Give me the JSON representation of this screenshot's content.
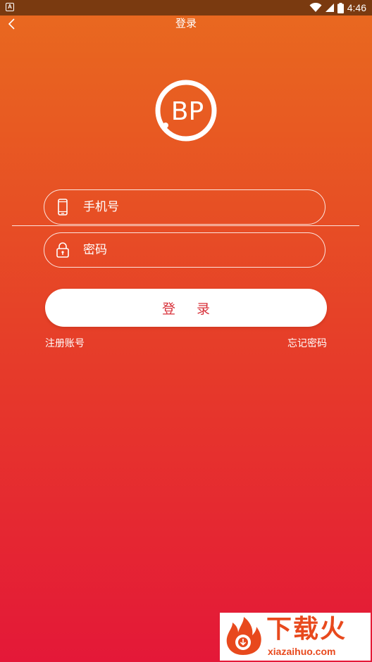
{
  "status_bar": {
    "notification_icon": "A",
    "icons": [
      "wifi-icon",
      "cell-signal-icon",
      "battery-icon"
    ],
    "time": "4:46"
  },
  "nav": {
    "back_icon": "chevron-left-icon",
    "title": "登录"
  },
  "logo": {
    "text": "BP"
  },
  "form": {
    "phone": {
      "icon": "phone-icon",
      "placeholder": "手机号"
    },
    "password": {
      "icon": "lock-icon",
      "placeholder": "密码"
    },
    "login_label": "登 录",
    "register_label": "注册账号",
    "forgot_label": "忘记密码"
  },
  "watermark": {
    "title": "下载火",
    "url": "xiazaihuo.com"
  },
  "colors": {
    "gradient_top": "#e96a1f",
    "gradient_bottom": "#e41838",
    "status_bar": "#7a3a10",
    "button_text": "#d8313a",
    "watermark_accent": "#e8491d"
  }
}
